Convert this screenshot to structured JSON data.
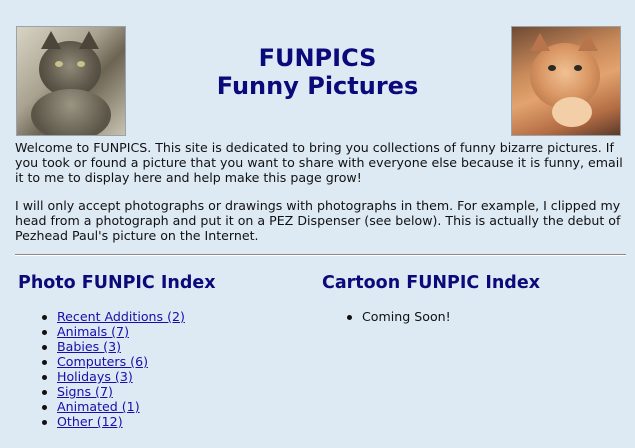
{
  "header": {
    "title_line1": "FUNPICS",
    "title_line2": "Funny Pictures",
    "title_color": "#0a0a7a"
  },
  "images": {
    "left": "gray tabby cat photo",
    "right": "orange kitten photo"
  },
  "intro": {
    "paragraph1": "Welcome to FUNPICS. This site is dedicated to bring you collections of funny bizarre pictures. If you took or found a picture that you want to share with everyone else because it is funny, email it to me to display here and help make this page grow!",
    "paragraph2": "I will only accept photographs or drawings with photographs in them. For example, I clipped my head from a photograph and put it on a PEZ Dispenser (see below). This is actually the debut of Pezhead Paul's picture on the Internet."
  },
  "photo_index": {
    "title": "Photo FUNPIC Index",
    "items": [
      {
        "label": "Recent Additions (2)"
      },
      {
        "label": "Animals (7)"
      },
      {
        "label": "Babies (3)"
      },
      {
        "label": "Computers (6)"
      },
      {
        "label": "Holidays (3)"
      },
      {
        "label": "Signs (7)"
      },
      {
        "label": "Animated (1)"
      },
      {
        "label": "Other (12)"
      }
    ]
  },
  "cartoon_index": {
    "title": "Cartoon FUNPIC Index",
    "items": [
      {
        "label": "Coming Soon!"
      }
    ]
  },
  "colors": {
    "background": "#dde9f3",
    "heading": "#0a0a7a",
    "link": "#1a0dab"
  }
}
